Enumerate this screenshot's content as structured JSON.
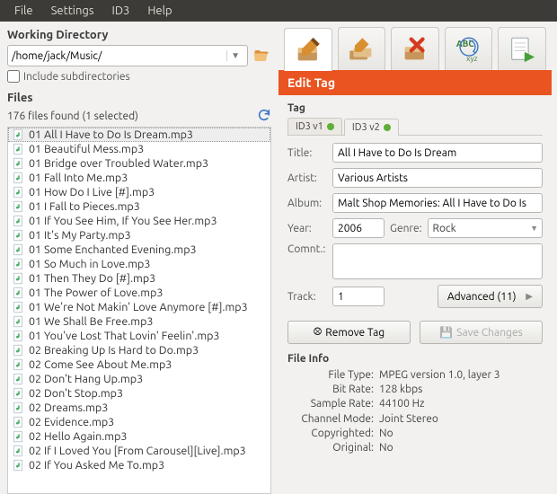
{
  "menu": [
    "File",
    "Settings",
    "ID3",
    "Help"
  ],
  "working_dir": {
    "label": "Working Directory",
    "path": "/home/jack/Music/",
    "include_sub_label": "Include subdirectories",
    "include_sub": false
  },
  "files": {
    "label": "Files",
    "status": "176 files found (1 selected)",
    "selected_index": 0,
    "items": [
      "01 All I Have to Do Is Dream.mp3",
      "01 Beautiful Mess.mp3",
      "01 Bridge over Troubled Water.mp3",
      "01 Fall Into Me.mp3",
      "01 How Do I Live [#].mp3",
      "01 I Fall to Pieces.mp3",
      "01 If You See Him, If You See Her.mp3",
      "01 It's My Party.mp3",
      "01 Some Enchanted Evening.mp3",
      "01 So Much in Love.mp3",
      "01 Then They Do [#].mp3",
      "01 The Power of Love.mp3",
      "01 We're Not Makin' Love Anymore [#].mp3",
      "01 We Shall Be Free.mp3",
      "01 You've Lost That Lovin' Feelin'.mp3",
      "02 Breaking Up Is Hard to Do.mp3",
      "02 Come See About Me.mp3",
      "02 Don't Hang Up.mp3",
      "02 Don't Stop.mp3",
      "02 Dreams.mp3",
      "02 Evidence.mp3",
      "02 Hello Again.mp3",
      "02 If I Loved You [From Carousel][Live].mp3",
      "02 If You Asked Me To.mp3"
    ]
  },
  "toolbar": {
    "icons": [
      "edit-tag",
      "edit-multi",
      "remove-tag",
      "rename",
      "playlist"
    ]
  },
  "panel": {
    "title": "Edit Tag",
    "tag_label": "Tag",
    "tabs": {
      "v1": "ID3 v1",
      "v2": "ID3 v2"
    },
    "fields": {
      "title_label": "Title:",
      "title": "All I Have to Do Is Dream",
      "artist_label": "Artist:",
      "artist": "Various Artists",
      "album_label": "Album:",
      "album": "Malt Shop Memories: All I Have to Do Is",
      "year_label": "Year:",
      "year": "2006",
      "genre_label": "Genre:",
      "genre": "Rock",
      "comnt_label": "Comnt.:",
      "comnt": "",
      "track_label": "Track:",
      "track": "1",
      "advanced_label": "Advanced (11)"
    },
    "buttons": {
      "remove": "Remove Tag",
      "save": "Save Changes"
    }
  },
  "file_info": {
    "label": "File Info",
    "rows": [
      {
        "k": "File Type:",
        "v": "MPEG version 1.0, layer 3"
      },
      {
        "k": "Bit Rate:",
        "v": "128 kbps"
      },
      {
        "k": "Sample Rate:",
        "v": "44100 Hz"
      },
      {
        "k": "Channel Mode:",
        "v": "Joint Stereo"
      },
      {
        "k": "Copyrighted:",
        "v": "No"
      },
      {
        "k": "Original:",
        "v": "No"
      }
    ]
  }
}
